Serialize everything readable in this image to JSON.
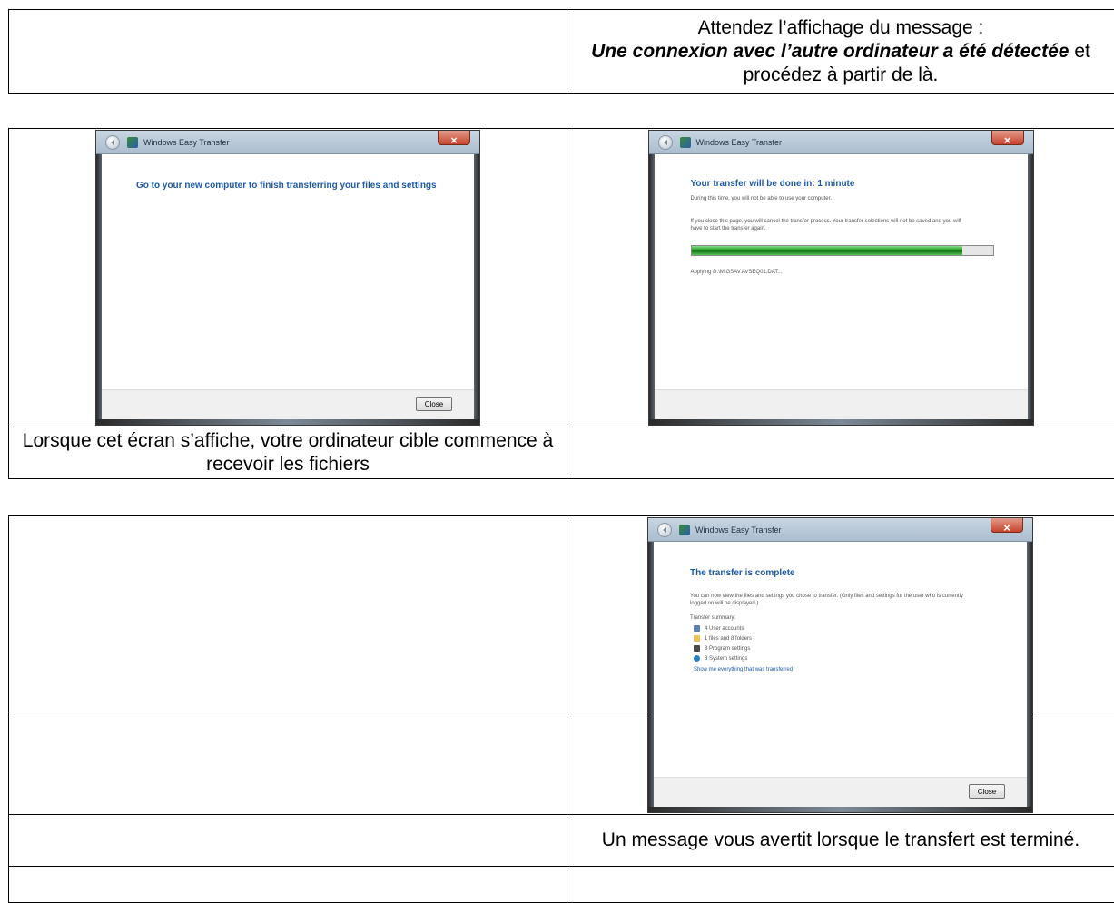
{
  "table1": {
    "instruction_line1": "Attendez l’affichage du message :",
    "instruction_em": "Une connexion avec l’autre ordinateur a été détectée",
    "instruction_tail": " et procédez à partir de là."
  },
  "table2": {
    "caption_left": "Lorsque cet écran s’affiche, votre ordinateur cible commence à recevoir les fichiers",
    "window_left": {
      "title": "Windows Easy Transfer",
      "heading": "Go to your new computer to finish transferring your files and settings",
      "close_button": "Close"
    },
    "window_right": {
      "title": "Windows Easy Transfer",
      "heading": "Your transfer will be done in: 1 minute",
      "line1": "During this time, you will not be able to use your computer.",
      "line2": "If you close this page, you will cancel the transfer process. Your transfer selections will not be saved and you will",
      "line3": "have to start the transfer again.",
      "progress": 0.9,
      "status": "Applying D:\\MIGSAV.AVSEQ01.DAT..."
    }
  },
  "table3": {
    "caption_right": "Un message vous avertit lorsque le transfert est terminé.",
    "window": {
      "title": "Windows Easy Transfer",
      "heading": "The transfer is complete",
      "line1": "You can now view the files and settings you chose to transfer. (Only files and settings for the user who is currently",
      "line2": "logged on will be displayed.)",
      "summary_label": "Transfer summary:",
      "summary": [
        {
          "icon": "users-icon",
          "text": "4 User accounts"
        },
        {
          "icon": "folder-icon",
          "text": "1 files and 8 folders"
        },
        {
          "icon": "program-settings-icon",
          "text": "8 Program settings"
        },
        {
          "icon": "system-settings-icon",
          "text": "8 System settings"
        }
      ],
      "link": "Show me everything that was transferred",
      "close_button": "Close"
    }
  }
}
